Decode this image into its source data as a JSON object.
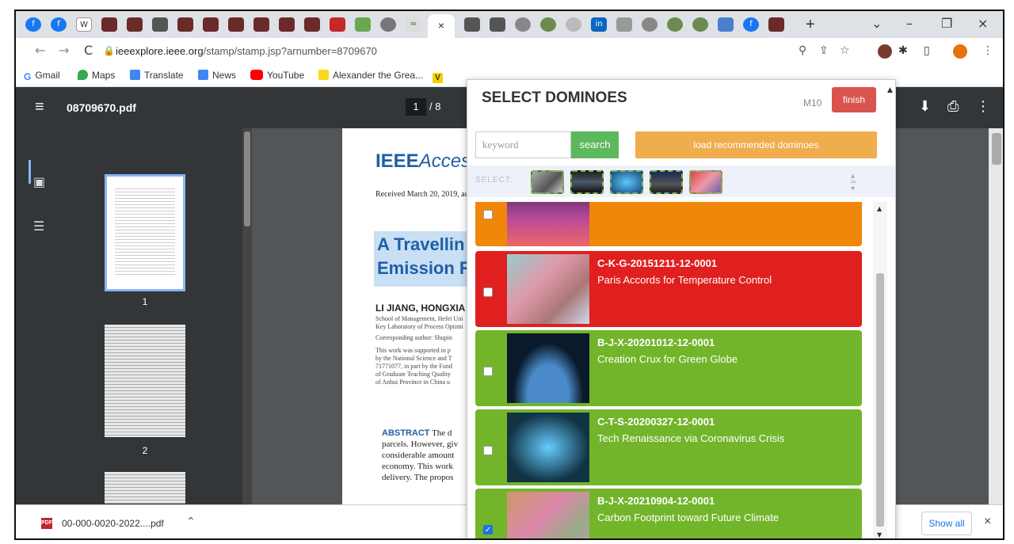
{
  "browser": {
    "active_tab_close": "×",
    "new_tab": "+",
    "window_controls": [
      "⌄",
      "–",
      "❐",
      "×"
    ],
    "url_host": "ieeexplore.ieee.org",
    "url_path": "/stamp/stamp.jsp?arnumber=8709670"
  },
  "bookmarks": [
    {
      "label": "Gmail",
      "color": "#ea4335"
    },
    {
      "label": "Maps",
      "color": "#34a853"
    },
    {
      "label": "Translate",
      "color": "#4285f4"
    },
    {
      "label": "News",
      "color": "#4285f4"
    },
    {
      "label": "YouTube",
      "color": "#ff0000"
    },
    {
      "label": "Alexander the Grea...",
      "color": "#f9d71c"
    }
  ],
  "pdf": {
    "filename": "08709670.pdf",
    "current_page": "1",
    "total_pages": "/ 8",
    "thumb_labels": [
      "1",
      "2"
    ]
  },
  "document": {
    "journal": "IEEE",
    "journal_italic": "Access",
    "received": "Received March 20, 2019, acc",
    "title_line1": "A Travellin",
    "title_line2": "Emission R",
    "authors": "LI JIANG, HONGXIA",
    "lines": [
      "School of Management, Hefei Uni",
      "Key Laboratory of Process Optimi",
      "Corresponding author: Shupin",
      "This work was supported in p",
      "by the National Science and T",
      "71771077, in part by the Fund",
      "of Graduate Teaching Quality",
      "of Anhui Province in China u"
    ],
    "abstract_label": "ABSTRACT",
    "abstract_lines": [
      "The d",
      "parcels. However, giv",
      "considerable amount",
      "economy. This work",
      "delivery. The propos"
    ]
  },
  "downloads": {
    "file": "00-000-0020-2022....pdf",
    "show_all": "Show all",
    "close": "×"
  },
  "popup": {
    "title": "SELECT DOMINOES",
    "mode": "M10",
    "finish": "finish",
    "keyword_placeholder": "keyword",
    "search": "search",
    "recommend": "load recommended dominoes",
    "select_label": "SELECT:",
    "cards": [
      {
        "id": "",
        "name": "",
        "color": "#f0860a",
        "checked": false
      },
      {
        "id": "C-K-G-20151211-12-0001",
        "name": "Paris Accords for Temperature Control",
        "color": "#e0201f",
        "checked": false
      },
      {
        "id": "B-J-X-20201012-12-0001",
        "name": "Creation Crux for Green Globe",
        "color": "#72b52b",
        "checked": false
      },
      {
        "id": "C-T-S-20200327-12-0001",
        "name": "Tech Renaissance via Coronavirus Crisis",
        "color": "#72b52b",
        "checked": false
      },
      {
        "id": "B-J-X-20210904-12-0001",
        "name": "Carbon Footprint toward Future Climate",
        "color": "#72b52b",
        "checked": true
      }
    ]
  }
}
